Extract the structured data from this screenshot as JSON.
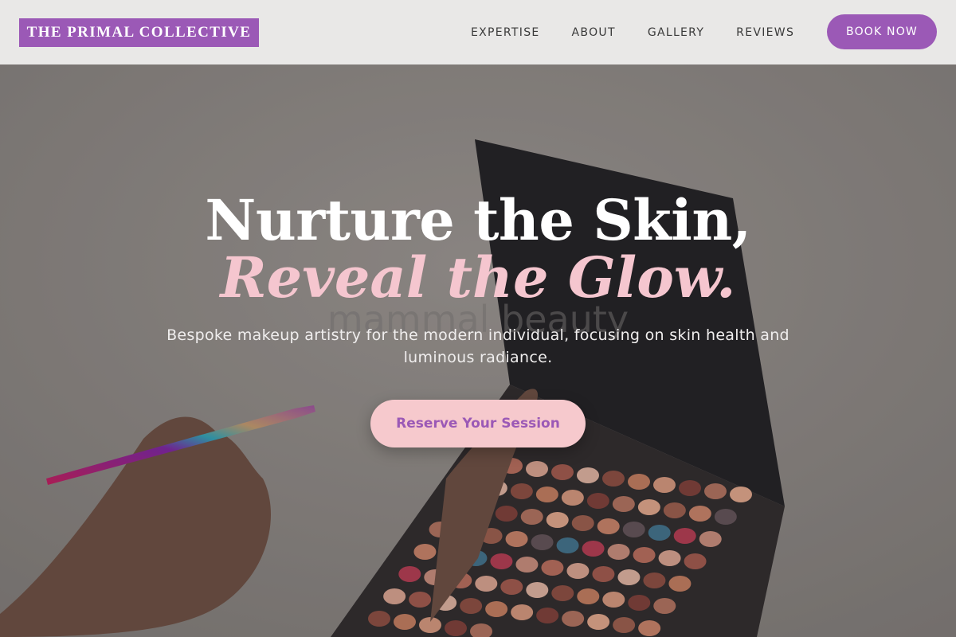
{
  "header": {
    "logo_text": "THE PRIMAL COLLECTIVE",
    "nav": [
      {
        "label": "EXPERTISE"
      },
      {
        "label": "ABOUT"
      },
      {
        "label": "GALLERY"
      },
      {
        "label": "REVIEWS"
      }
    ],
    "book_label": "BOOK NOW"
  },
  "hero": {
    "headline_line1": "Nurture the Skin,",
    "headline_line2": "Reveal the Glow.",
    "subtitle": "Bespoke makeup artistry for the modern individual, focusing on skin health and luminous radiance.",
    "cta_label": "Reserve Your Session",
    "laptop_watermark": "mammal beauty"
  },
  "colors": {
    "brand_purple": "#9b59b6",
    "accent_pink": "#f6c9cd",
    "headline_pink": "#f5c6cf",
    "header_bg": "#e9e8e7"
  }
}
